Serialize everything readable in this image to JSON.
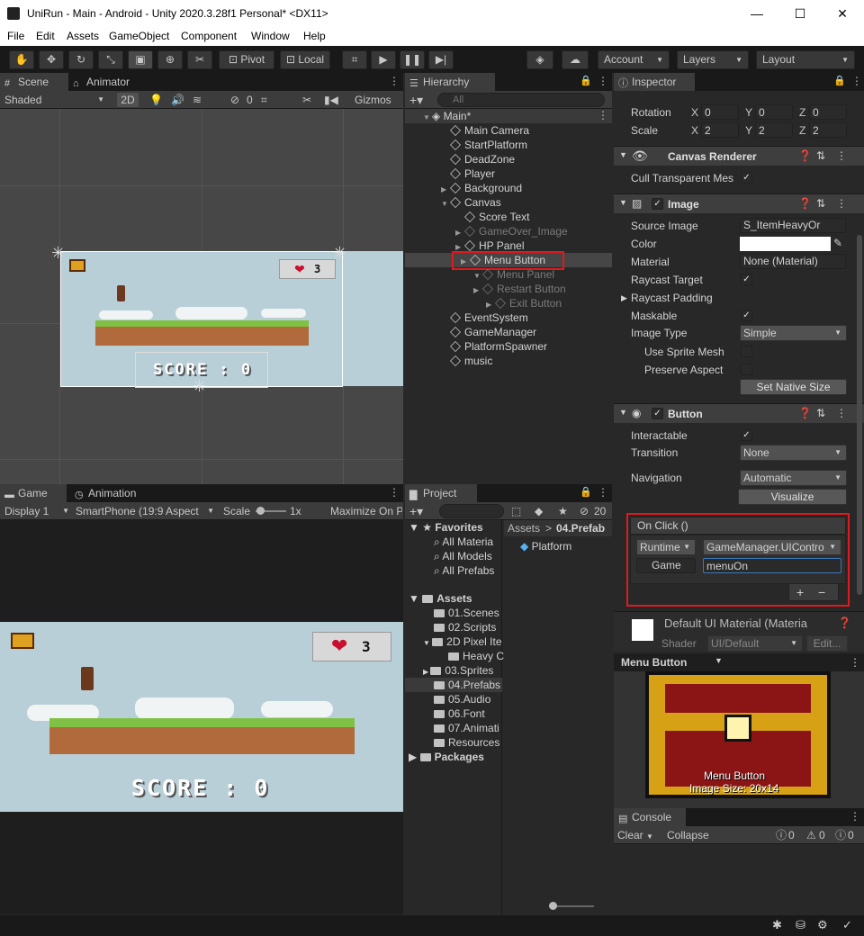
{
  "window": {
    "title": "UniRun - Main - Android - Unity 2020.3.28f1 Personal* <DX11>",
    "minimize": "—",
    "maximize": "☐",
    "close": "✕"
  },
  "menu": [
    "File",
    "Edit",
    "Assets",
    "GameObject",
    "Component",
    "Window",
    "Help"
  ],
  "toolbar": {
    "pivot": "Pivot",
    "local": "Local",
    "account": "Account",
    "layers": "Layers",
    "layout": "Layout"
  },
  "scene": {
    "tab_scene": "Scene",
    "tab_animator": "Animator",
    "shading": "Shaded",
    "mode2d": "2D",
    "hidden_count": "0",
    "gizmos": "Gizmos",
    "score_text": "SCORE : 0",
    "hp_value": "3"
  },
  "game": {
    "tab_game": "Game",
    "tab_animation": "Animation",
    "display": "Display 1",
    "aspect": "SmartPhone (19:9 Aspect",
    "scale_label": "Scale",
    "scale_value": "1x",
    "maximize": "Maximize On P",
    "score_text": "SCORE : 0",
    "hp_value": "3"
  },
  "hierarchy": {
    "tab": "Hierarchy",
    "search_placeholder": "All",
    "items": [
      {
        "label": "Main*",
        "depth": 0
      },
      {
        "label": "Main Camera",
        "depth": 1
      },
      {
        "label": "StartPlatform",
        "depth": 1
      },
      {
        "label": "DeadZone",
        "depth": 1
      },
      {
        "label": "Player",
        "depth": 1
      },
      {
        "label": "Background",
        "depth": 1
      },
      {
        "label": "Canvas",
        "depth": 1
      },
      {
        "label": "Score Text",
        "depth": 2
      },
      {
        "label": "GameOver_Image",
        "depth": 2
      },
      {
        "label": "HP Panel",
        "depth": 2
      },
      {
        "label": "Menu Button",
        "depth": 2
      },
      {
        "label": "Menu Panel",
        "depth": 2
      },
      {
        "label": "Restart Button",
        "depth": 3
      },
      {
        "label": "Exit Button",
        "depth": 3
      },
      {
        "label": "EventSystem",
        "depth": 1
      },
      {
        "label": "GameManager",
        "depth": 1
      },
      {
        "label": "PlatformSpawner",
        "depth": 1
      },
      {
        "label": "music",
        "depth": 1
      }
    ]
  },
  "project": {
    "tab": "Project",
    "count": "20",
    "favorites": "Favorites",
    "fav_items": [
      "All Materia",
      "All Models",
      "All Prefabs"
    ],
    "assets": "Assets",
    "asset_items": [
      "01.Scenes",
      "02.Scripts",
      "2D Pixel Ite",
      "Heavy C",
      "03.Sprites",
      "04.Prefabs",
      "05.Audio",
      "06.Font",
      "07.Animati",
      "Resources"
    ],
    "packages": "Packages",
    "breadcrumb_root": "Assets",
    "breadcrumb_sep": ">",
    "breadcrumb_current": "04.Prefab",
    "content_item": "Platform"
  },
  "inspector": {
    "tab": "Inspector",
    "rotation_label": "Rotation",
    "rotation": [
      "0",
      "0",
      "0"
    ],
    "scale_label": "Scale",
    "scale": [
      "2",
      "2",
      "2"
    ],
    "x": "X",
    "y": "Y",
    "z": "Z",
    "canvas_renderer": "Canvas Renderer",
    "cull_label": "Cull Transparent Mes",
    "image": "Image",
    "source_image_label": "Source Image",
    "source_image": "S_ItemHeavyOr",
    "color_label": "Color",
    "material_label": "Material",
    "material": "None (Material)",
    "raycast_target_label": "Raycast Target",
    "raycast_padding_label": "Raycast Padding",
    "maskable_label": "Maskable",
    "image_type_label": "Image Type",
    "image_type": "Simple",
    "use_sprite_mesh_label": "Use Sprite Mesh",
    "preserve_aspect_label": "Preserve Aspect",
    "set_native_size": "Set Native Size",
    "button": "Button",
    "interactable_label": "Interactable",
    "transition_label": "Transition",
    "transition": "None",
    "navigation_label": "Navigation",
    "navigation": "Automatic",
    "visualize": "Visualize",
    "onclick_title": "On Click ()",
    "runtime": "Runtime",
    "function": "GameManager.UIContro",
    "object": "Game",
    "argument": "menuOn",
    "plus": "+",
    "minus": "−",
    "default_material": "Default UI Material (Materia",
    "shader_label": "Shader",
    "shader": "UI/Default",
    "edit": "Edit...",
    "preview_title": "Menu Button",
    "preview_name": "Menu Button",
    "preview_size": "Image Size: 20x14"
  },
  "console": {
    "tab": "Console",
    "clear": "Clear",
    "collapse": "Collapse",
    "logs": "0",
    "warnings": "0",
    "errors": "0"
  }
}
